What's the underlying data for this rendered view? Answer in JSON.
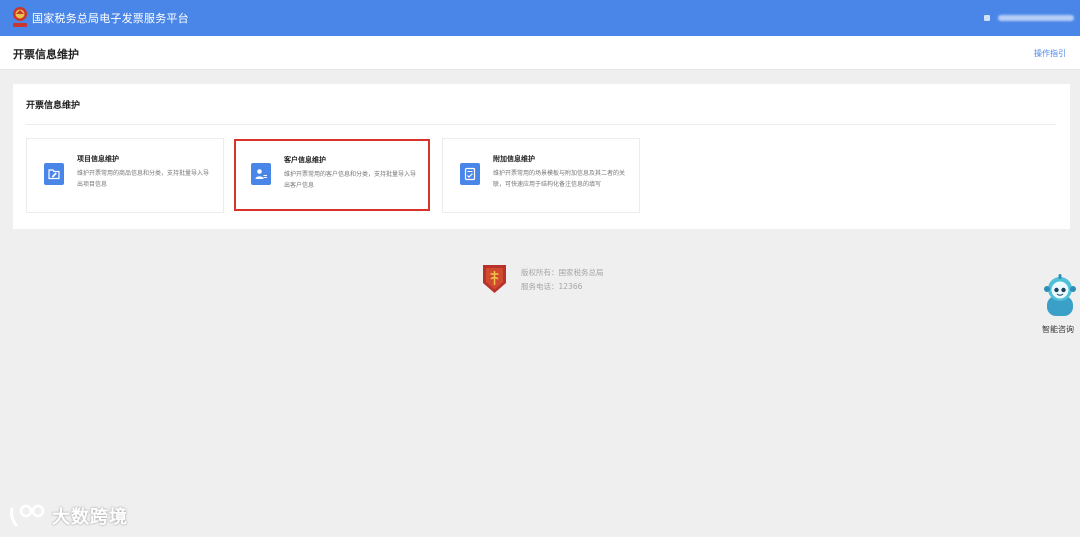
{
  "header": {
    "app_title": "国家税务总局电子发票服务平台",
    "emblem_icon": "tax-emblem-icon",
    "user_icon": "user-icon"
  },
  "page": {
    "title": "开票信息维护",
    "help_link": "操作指引"
  },
  "section": {
    "title": "开票信息维护",
    "cards": [
      {
        "title": "项目信息维护",
        "desc": "维护开票常用的商品信息和分类，支持批量导入导出项目信息",
        "icon": "folder-edit-icon",
        "selected": false
      },
      {
        "title": "客户信息维护",
        "desc": "维护开票常用的客户信息和分类，支持批量导入导出客户信息",
        "icon": "user-card-icon",
        "selected": true
      },
      {
        "title": "附加信息维护",
        "desc": "维护开票常用的场景模板与附加信息及其二者的关联，可快速应用于结构化备注信息的填写",
        "icon": "document-check-icon",
        "selected": false
      }
    ]
  },
  "footer": {
    "copyright": "版权所有：国家税务总局",
    "phone": "服务电话：12366"
  },
  "assistant": {
    "label": "智能咨询"
  },
  "watermark": {
    "text": "大数跨境"
  },
  "colors": {
    "primary": "#4a86e8",
    "selected_border": "#d9342b",
    "background": "#efefef"
  }
}
